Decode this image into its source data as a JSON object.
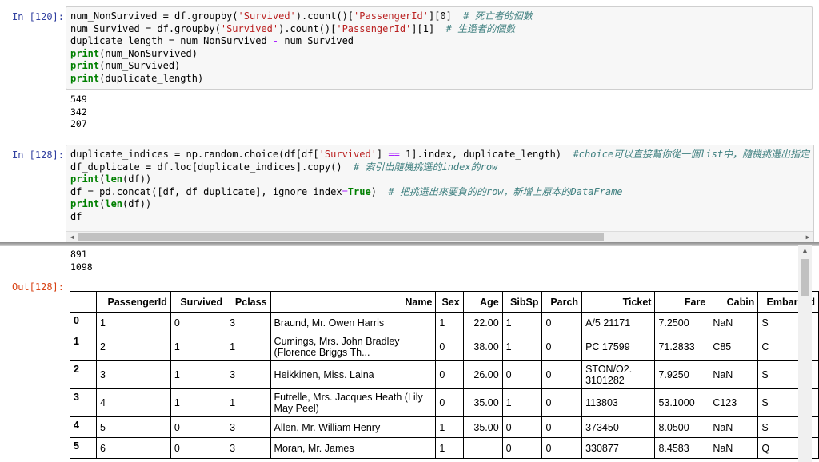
{
  "cell1": {
    "prompt": "In [120]:",
    "lines": [
      [
        {
          "t": "num_NonSurvived = df.groupby(",
          "c": ""
        },
        {
          "t": "'Survived'",
          "c": "str"
        },
        {
          "t": ").count()[",
          "c": ""
        },
        {
          "t": "'PassengerId'",
          "c": "str"
        },
        {
          "t": "][0]  ",
          "c": ""
        },
        {
          "t": "# 死亡者的個數",
          "c": "cm"
        }
      ],
      [
        {
          "t": "num_Survived = df.groupby(",
          "c": ""
        },
        {
          "t": "'Survived'",
          "c": "str"
        },
        {
          "t": ").count()[",
          "c": ""
        },
        {
          "t": "'PassengerId'",
          "c": "str"
        },
        {
          "t": "][1]  ",
          "c": ""
        },
        {
          "t": "# 生還者的個數",
          "c": "cm"
        }
      ],
      [
        {
          "t": "duplicate_length = num_NonSurvived ",
          "c": ""
        },
        {
          "t": "-",
          "c": "op"
        },
        {
          "t": " num_Survived",
          "c": ""
        }
      ],
      [
        {
          "t": "print",
          "c": "kw"
        },
        {
          "t": "(num_NonSurvived)",
          "c": ""
        }
      ],
      [
        {
          "t": "print",
          "c": "kw"
        },
        {
          "t": "(num_Survived)",
          "c": ""
        }
      ],
      [
        {
          "t": "print",
          "c": "kw"
        },
        {
          "t": "(duplicate_length)",
          "c": ""
        }
      ]
    ],
    "output": "549\n342\n207"
  },
  "cell2": {
    "prompt": "In [128]:",
    "out_prompt": "Out[128]:",
    "lines": [
      [
        {
          "t": "duplicate_indices = np.random.choice(df[df[",
          "c": ""
        },
        {
          "t": "'Survived'",
          "c": "str"
        },
        {
          "t": "] ",
          "c": ""
        },
        {
          "t": "==",
          "c": "op"
        },
        {
          "t": " 1].index, duplicate_length)  ",
          "c": ""
        },
        {
          "t": "#choice可以直接幫你從一個list中，隨機挑選出指定",
          "c": "cm"
        }
      ],
      [
        {
          "t": "df_duplicate = df.loc[duplicate_indices].copy()  ",
          "c": ""
        },
        {
          "t": "# 索引出隨機挑選的index的row",
          "c": "cm"
        }
      ],
      [
        {
          "t": "print",
          "c": "kw"
        },
        {
          "t": "(",
          "c": ""
        },
        {
          "t": "len",
          "c": "kw"
        },
        {
          "t": "(df))",
          "c": ""
        }
      ],
      [
        {
          "t": "df = pd.concat([df, df_duplicate], ignore_index",
          "c": ""
        },
        {
          "t": "=",
          "c": "op"
        },
        {
          "t": "True",
          "c": "kw"
        },
        {
          "t": ")  ",
          "c": ""
        },
        {
          "t": "# 把挑選出來要負的的row，新增上原本的DataFrame",
          "c": "cm"
        }
      ],
      [
        {
          "t": "print",
          "c": "kw"
        },
        {
          "t": "(",
          "c": ""
        },
        {
          "t": "len",
          "c": "kw"
        },
        {
          "t": "(df))",
          "c": ""
        }
      ],
      [
        {
          "t": "df",
          "c": ""
        }
      ]
    ],
    "output": "891\n1098"
  },
  "table": {
    "columns": [
      "",
      "PassengerId",
      "Survived",
      "Pclass",
      "Name",
      "Sex",
      "Age",
      "SibSp",
      "Parch",
      "Ticket",
      "Fare",
      "Cabin",
      "Embarked"
    ],
    "rows": [
      [
        "0",
        "1",
        "0",
        "3",
        "Braund, Mr. Owen Harris",
        "1",
        "22.00",
        "1",
        "0",
        "A/5 21171",
        "7.2500",
        "NaN",
        "S"
      ],
      [
        "1",
        "2",
        "1",
        "1",
        "Cumings, Mrs. John Bradley (Florence Briggs Th...",
        "0",
        "38.00",
        "1",
        "0",
        "PC 17599",
        "71.2833",
        "C85",
        "C"
      ],
      [
        "2",
        "3",
        "1",
        "3",
        "Heikkinen, Miss. Laina",
        "0",
        "26.00",
        "0",
        "0",
        "STON/O2. 3101282",
        "7.9250",
        "NaN",
        "S"
      ],
      [
        "3",
        "4",
        "1",
        "1",
        "Futrelle, Mrs. Jacques Heath (Lily May Peel)",
        "0",
        "35.00",
        "1",
        "0",
        "113803",
        "53.1000",
        "C123",
        "S"
      ],
      [
        "4",
        "5",
        "0",
        "3",
        "Allen, Mr. William Henry",
        "1",
        "35.00",
        "0",
        "0",
        "373450",
        "8.0500",
        "NaN",
        "S"
      ],
      [
        "5",
        "6",
        "0",
        "3",
        "Moran, Mr. James",
        "1",
        "",
        "0",
        "0",
        "330877",
        "8.4583",
        "NaN",
        "Q"
      ]
    ]
  }
}
